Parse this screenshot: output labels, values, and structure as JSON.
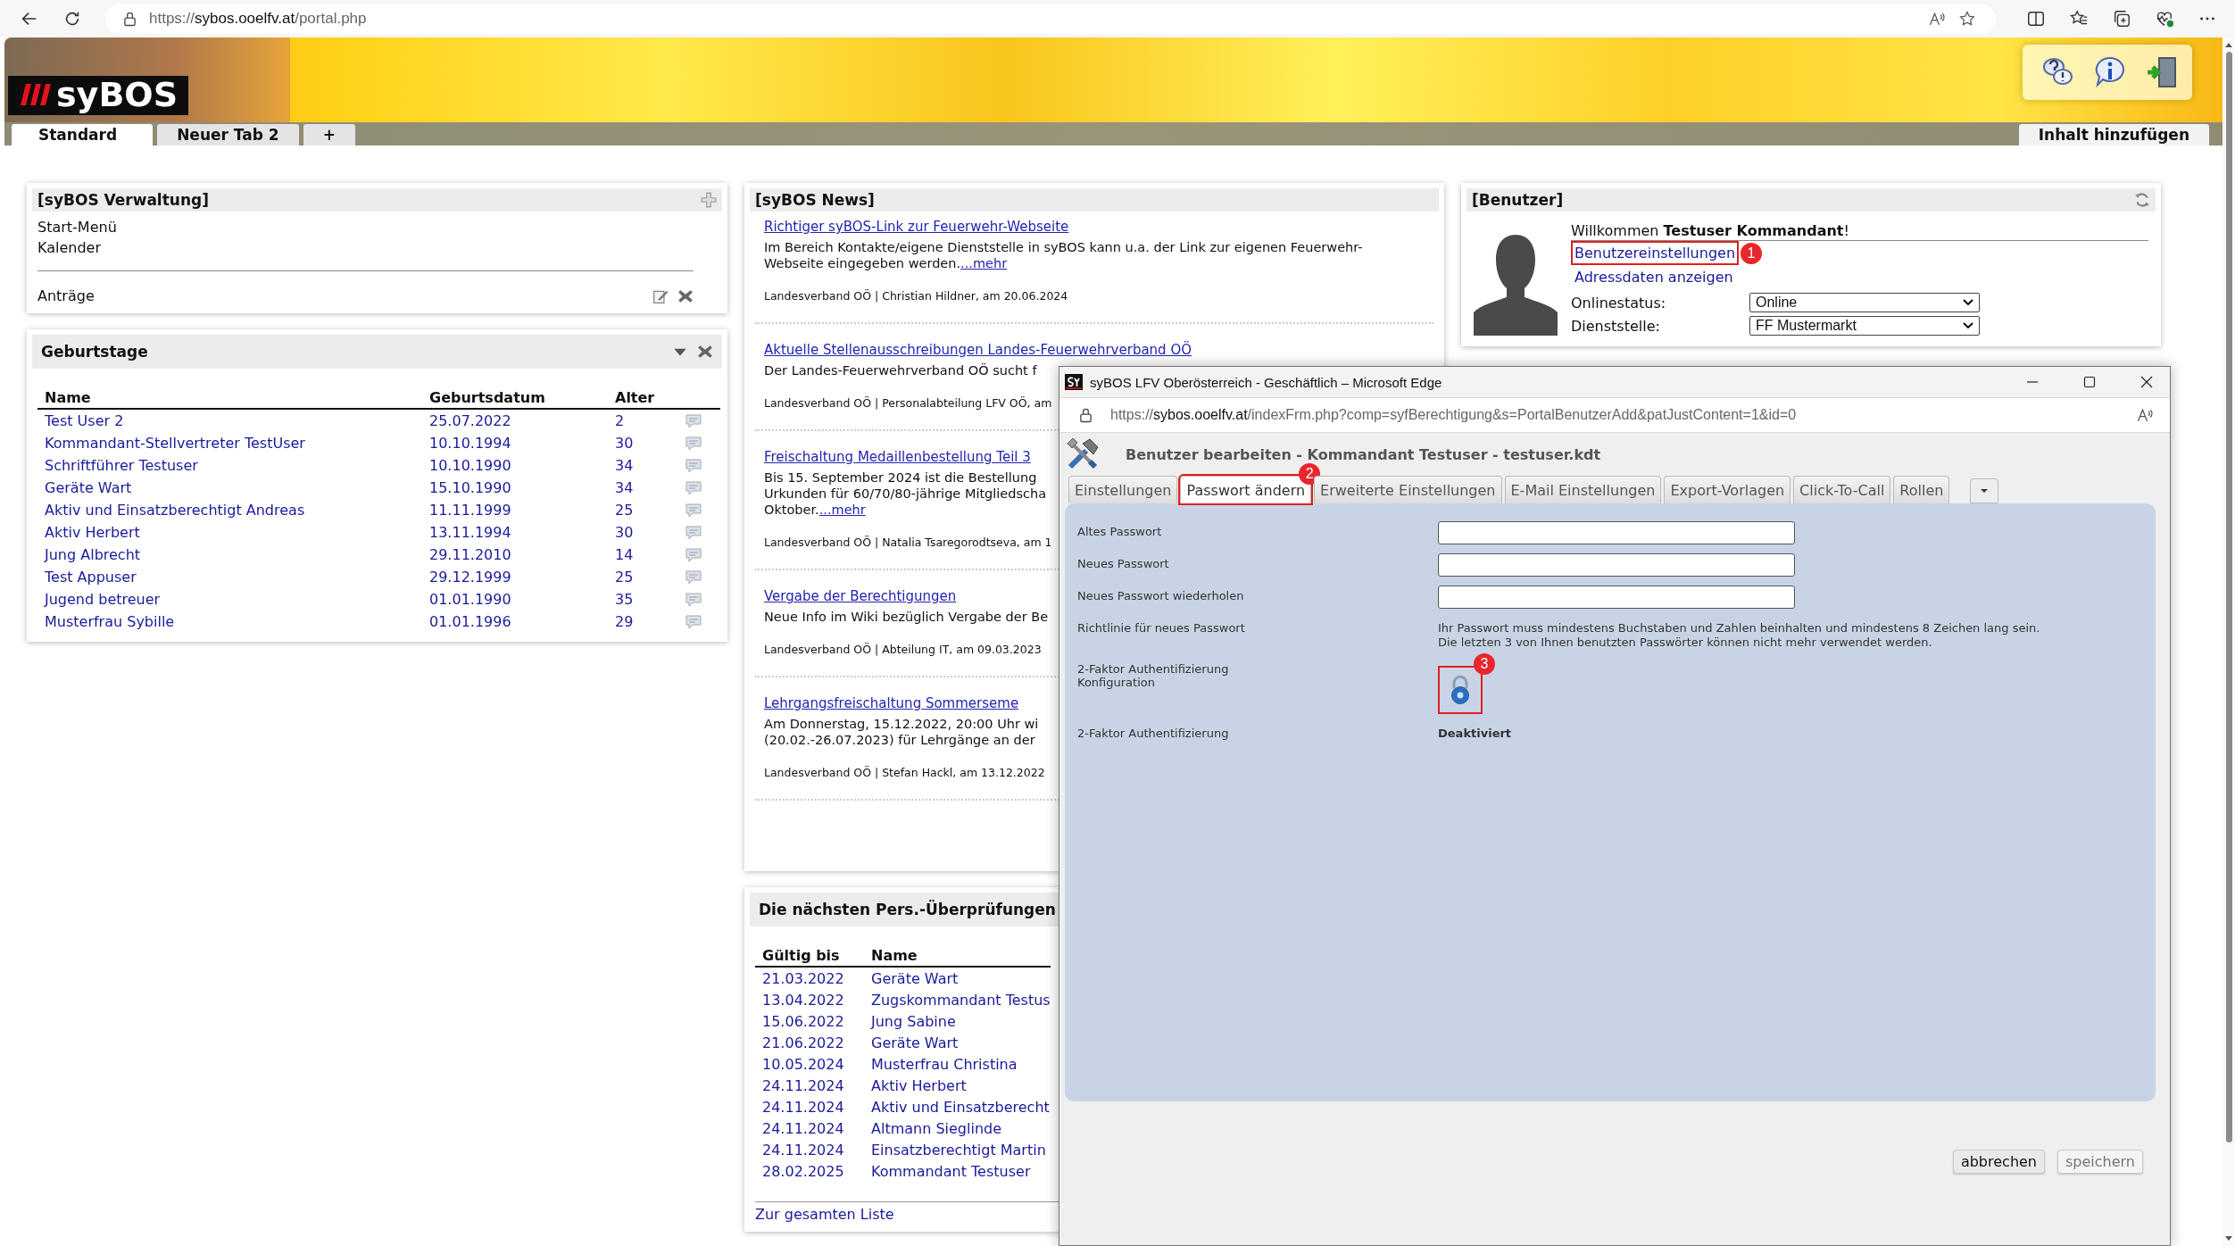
{
  "browser": {
    "url": "https://sybos.ooelfv.at/portal.php"
  },
  "header": {
    "logo": "syBOS",
    "tabs": [
      {
        "label": "Standard",
        "selected": true
      },
      {
        "label": "Neuer Tab 2",
        "selected": false
      },
      {
        "label": "+",
        "selected": false
      }
    ],
    "add_content": "Inhalt hinzufügen"
  },
  "verwaltung": {
    "title": "[syBOS Verwaltung]",
    "items": [
      "Start-Menü",
      "Kalender"
    ],
    "requests": "Anträge"
  },
  "birthdays": {
    "title": "Geburtstage",
    "columns": [
      "Name",
      "Geburtsdatum",
      "Alter"
    ],
    "rows": [
      {
        "name": "Test User 2",
        "date": "25.07.2022",
        "age": "2"
      },
      {
        "name": "Kommandant-Stellvertreter TestUser",
        "date": "10.10.1994",
        "age": "30"
      },
      {
        "name": "Schriftführer Testuser",
        "date": "10.10.1990",
        "age": "34"
      },
      {
        "name": "Geräte Wart",
        "date": "15.10.1990",
        "age": "34"
      },
      {
        "name": "Aktiv und Einsatzberechtigt Andreas",
        "date": "11.11.1999",
        "age": "25"
      },
      {
        "name": "Aktiv Herbert",
        "date": "13.11.1994",
        "age": "30"
      },
      {
        "name": "Jung Albrecht",
        "date": "29.11.2010",
        "age": "14"
      },
      {
        "name": "Test Appuser",
        "date": "29.12.1999",
        "age": "25"
      },
      {
        "name": "Jugend betreuer",
        "date": "01.01.1990",
        "age": "35"
      },
      {
        "name": "Musterfrau Sybille",
        "date": "01.01.1996",
        "age": "29"
      }
    ]
  },
  "news": {
    "title": "[syBOS News]",
    "items": [
      {
        "title": "Richtiger syBOS-Link zur Feuerwehr-Webseite",
        "lines": [
          "Im Bereich Kontakte/eigene Dienststelle in syBOS kann u.a. der Link zur eigenen Feuerwehr-",
          "Webseite eingegeben werden."
        ],
        "more": "...mehr",
        "meta": "Landesverband OÖ | Christian Hildner, am 20.06.2024"
      },
      {
        "title": "Aktuelle Stellenausschreibungen Landes-Feuerwehrverband OÖ",
        "lines": [
          "Der Landes-Feuerwehrverband OÖ sucht f"
        ],
        "meta": "Landesverband OÖ | Personalabteilung LFV OÖ, am"
      },
      {
        "title": "Freischaltung Medaillenbestellung Teil 3",
        "lines": [
          "Bis 15. September 2024 ist die Bestellung",
          "Urkunden für 60/70/80-jährige Mitgliedscha",
          "Oktober."
        ],
        "more": "...mehr",
        "meta": "Landesverband OÖ | Natalia Tsaregorodtseva, am 1"
      },
      {
        "title": "Vergabe der Berechtigungen",
        "lines": [
          "Neue Info im Wiki bezüglich Vergabe der Be"
        ],
        "meta": "Landesverband OÖ | Abteilung IT, am 09.03.2023"
      },
      {
        "title": "Lehrgangsfreischaltung Sommerseme",
        "lines": [
          "Am Donnerstag, 15.12.2022, 20:00 Uhr wi",
          "(20.02.-26.07.2023) für Lehrgänge an der"
        ],
        "meta": "Landesverband OÖ | Stefan Hackl, am 13.12.2022"
      }
    ]
  },
  "inspections": {
    "title": "Die nächsten Pers.-Überprüfungen",
    "columns": [
      "Gültig bis",
      "Name"
    ],
    "rows": [
      {
        "date": "21.03.2022",
        "name": "Geräte Wart"
      },
      {
        "date": "13.04.2022",
        "name": "Zugskommandant Testus"
      },
      {
        "date": "15.06.2022",
        "name": "Jung Sabine"
      },
      {
        "date": "21.06.2022",
        "name": "Geräte Wart"
      },
      {
        "date": "10.05.2024",
        "name": "Musterfrau Christina"
      },
      {
        "date": "24.11.2024",
        "name": "Aktiv Herbert"
      },
      {
        "date": "24.11.2024",
        "name": "Aktiv und Einsatzberecht"
      },
      {
        "date": "24.11.2024",
        "name": "Altmann Sieglinde"
      },
      {
        "date": "24.11.2024",
        "name": "Einsatzberechtigt Martin"
      },
      {
        "date": "28.02.2025",
        "name": "Kommandant Testuser"
      }
    ],
    "footer_link": "Zur gesamten Liste"
  },
  "user": {
    "title": "[Benutzer]",
    "welcome": "Willkommen **Testuser Kommandant**!",
    "links": [
      {
        "label": "Benutzereinstellungen",
        "callout": "1"
      },
      {
        "label": "Adressdaten anzeigen"
      }
    ],
    "fields": [
      {
        "label": "Onlinestatus:",
        "value": "Online"
      },
      {
        "label": "Dienststelle:",
        "value": "FF Mustermarkt"
      }
    ]
  },
  "popup": {
    "title": "syBOS LFV Oberösterreich - Geschäftlich – Microsoft Edge",
    "url": "https://sybos.ooelfv.at/indexFrm.php?comp=syfBerechtigung&s=PortalBenutzerAdd&patJustContent=1&id=0",
    "heading": "Benutzer bearbeiten - Kommandant Testuser - testuser.kdt",
    "tabs": [
      {
        "label": "Einstellungen",
        "selected": false
      },
      {
        "label": "Passwort ändern",
        "selected": true,
        "callout": "2"
      },
      {
        "label": "Erweiterte Einstellungen",
        "selected": false
      },
      {
        "label": "E-Mail Einstellungen",
        "selected": false
      },
      {
        "label": "Export-Vorlagen",
        "selected": false
      },
      {
        "label": "Click-To-Call",
        "selected": false
      },
      {
        "label": "Rollen",
        "selected": false
      }
    ],
    "rows": [
      {
        "kind": "password",
        "label": "Altes Passwort"
      },
      {
        "kind": "password",
        "label": "Neues Passwort"
      },
      {
        "kind": "password",
        "label": "Neues Passwort wiederholen"
      },
      {
        "kind": "text",
        "label": "Richtlinie für neues Passwort",
        "lines": [
          "Ihr Passwort muss mindestens Buchstaben und Zahlen beinhalten und mindestens 8 Zeichen lang sein.",
          "Die letzten 3 von Ihnen benutzten Passwörter können nicht mehr verwendet werden."
        ]
      },
      {
        "kind": "lock",
        "label": "2-Faktor Authentifizierung Konfiguration",
        "callout": "3"
      },
      {
        "kind": "status",
        "label": "2-Faktor Authentifizierung",
        "value": "Deaktiviert"
      }
    ],
    "buttons": [
      {
        "label": "abbrechen",
        "disabled": false
      },
      {
        "label": "speichern",
        "disabled": true
      }
    ]
  }
}
